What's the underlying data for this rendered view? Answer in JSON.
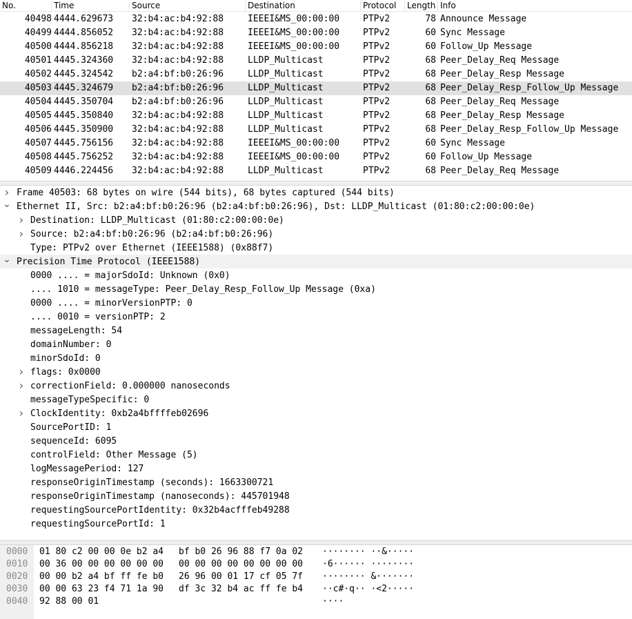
{
  "packet_list": {
    "columns": {
      "no": "No.",
      "time": "Time",
      "source": "Source",
      "destination": "Destination",
      "protocol": "Protocol",
      "length": "Length",
      "info": "Info"
    },
    "rows": [
      {
        "no": "40498",
        "time": "4444.629673",
        "source": "32:b4:ac:b4:92:88",
        "destination": "IEEEI&MS_00:00:00",
        "protocol": "PTPv2",
        "length": "78",
        "info": "Announce Message",
        "selected": false
      },
      {
        "no": "40499",
        "time": "4444.856052",
        "source": "32:b4:ac:b4:92:88",
        "destination": "IEEEI&MS_00:00:00",
        "protocol": "PTPv2",
        "length": "60",
        "info": "Sync Message",
        "selected": false
      },
      {
        "no": "40500",
        "time": "4444.856218",
        "source": "32:b4:ac:b4:92:88",
        "destination": "IEEEI&MS_00:00:00",
        "protocol": "PTPv2",
        "length": "60",
        "info": "Follow_Up Message",
        "selected": false
      },
      {
        "no": "40501",
        "time": "4445.324360",
        "source": "32:b4:ac:b4:92:88",
        "destination": "LLDP_Multicast",
        "protocol": "PTPv2",
        "length": "68",
        "info": "Peer_Delay_Req Message",
        "selected": false
      },
      {
        "no": "40502",
        "time": "4445.324542",
        "source": "b2:a4:bf:b0:26:96",
        "destination": "LLDP_Multicast",
        "protocol": "PTPv2",
        "length": "68",
        "info": "Peer_Delay_Resp Message",
        "selected": false
      },
      {
        "no": "40503",
        "time": "4445.324679",
        "source": "b2:a4:bf:b0:26:96",
        "destination": "LLDP_Multicast",
        "protocol": "PTPv2",
        "length": "68",
        "info": "Peer_Delay_Resp_Follow_Up Message",
        "selected": true
      },
      {
        "no": "40504",
        "time": "4445.350704",
        "source": "b2:a4:bf:b0:26:96",
        "destination": "LLDP_Multicast",
        "protocol": "PTPv2",
        "length": "68",
        "info": "Peer_Delay_Req Message",
        "selected": false
      },
      {
        "no": "40505",
        "time": "4445.350840",
        "source": "32:b4:ac:b4:92:88",
        "destination": "LLDP_Multicast",
        "protocol": "PTPv2",
        "length": "68",
        "info": "Peer_Delay_Resp Message",
        "selected": false
      },
      {
        "no": "40506",
        "time": "4445.350900",
        "source": "32:b4:ac:b4:92:88",
        "destination": "LLDP_Multicast",
        "protocol": "PTPv2",
        "length": "68",
        "info": "Peer_Delay_Resp_Follow_Up Message",
        "selected": false
      },
      {
        "no": "40507",
        "time": "4445.756156",
        "source": "32:b4:ac:b4:92:88",
        "destination": "IEEEI&MS_00:00:00",
        "protocol": "PTPv2",
        "length": "60",
        "info": "Sync Message",
        "selected": false
      },
      {
        "no": "40508",
        "time": "4445.756252",
        "source": "32:b4:ac:b4:92:88",
        "destination": "IEEEI&MS_00:00:00",
        "protocol": "PTPv2",
        "length": "60",
        "info": "Follow_Up Message",
        "selected": false
      },
      {
        "no": "40509",
        "time": "4446.224456",
        "source": "32:b4:ac:b4:92:88",
        "destination": "LLDP_Multicast",
        "protocol": "PTPv2",
        "length": "68",
        "info": "Peer_Delay_Req Message",
        "selected": false
      }
    ]
  },
  "details": [
    {
      "text": "Frame 40503: 68 bytes on wire (544 bits), 68 bytes captured (544 bits)",
      "level": 0,
      "expander": "collapsed",
      "highlight": false
    },
    {
      "text": "Ethernet II, Src: b2:a4:bf:b0:26:96 (b2:a4:bf:b0:26:96), Dst: LLDP_Multicast (01:80:c2:00:00:0e)",
      "level": 0,
      "expander": "expanded",
      "highlight": false
    },
    {
      "text": "Destination: LLDP_Multicast (01:80:c2:00:00:0e)",
      "level": 1,
      "expander": "collapsed",
      "highlight": false
    },
    {
      "text": "Source: b2:a4:bf:b0:26:96 (b2:a4:bf:b0:26:96)",
      "level": 1,
      "expander": "collapsed",
      "highlight": false
    },
    {
      "text": "Type: PTPv2 over Ethernet (IEEE1588) (0x88f7)",
      "level": 1,
      "expander": "none",
      "highlight": false
    },
    {
      "text": "Precision Time Protocol (IEEE1588)",
      "level": 0,
      "expander": "expanded",
      "highlight": true
    },
    {
      "text": "0000 .... = majorSdoId: Unknown (0x0)",
      "level": 1,
      "expander": "none",
      "highlight": false
    },
    {
      "text": ".... 1010 = messageType: Peer_Delay_Resp_Follow_Up Message (0xa)",
      "level": 1,
      "expander": "none",
      "highlight": false
    },
    {
      "text": "0000 .... = minorVersionPTP: 0",
      "level": 1,
      "expander": "none",
      "highlight": false
    },
    {
      "text": ".... 0010 = versionPTP: 2",
      "level": 1,
      "expander": "none",
      "highlight": false
    },
    {
      "text": "messageLength: 54",
      "level": 1,
      "expander": "none",
      "highlight": false
    },
    {
      "text": "domainNumber: 0",
      "level": 1,
      "expander": "none",
      "highlight": false
    },
    {
      "text": "minorSdoId: 0",
      "level": 1,
      "expander": "none",
      "highlight": false
    },
    {
      "text": "flags: 0x0000",
      "level": 1,
      "expander": "collapsed",
      "highlight": false
    },
    {
      "text": "correctionField: 0.000000 nanoseconds",
      "level": 1,
      "expander": "collapsed",
      "highlight": false
    },
    {
      "text": "messageTypeSpecific: 0",
      "level": 1,
      "expander": "none",
      "highlight": false
    },
    {
      "text": "ClockIdentity: 0xb2a4bffffeb02696",
      "level": 1,
      "expander": "collapsed",
      "highlight": false
    },
    {
      "text": "SourcePortID: 1",
      "level": 1,
      "expander": "none",
      "highlight": false
    },
    {
      "text": "sequenceId: 6095",
      "level": 1,
      "expander": "none",
      "highlight": false
    },
    {
      "text": "controlField: Other Message (5)",
      "level": 1,
      "expander": "none",
      "highlight": false
    },
    {
      "text": "logMessagePeriod: 127",
      "level": 1,
      "expander": "none",
      "highlight": false
    },
    {
      "text": "responseOriginTimestamp (seconds): 1663300721",
      "level": 1,
      "expander": "none",
      "highlight": false
    },
    {
      "text": "responseOriginTimestamp (nanoseconds): 445701948",
      "level": 1,
      "expander": "none",
      "highlight": false
    },
    {
      "text": "requestingSourcePortIdentity: 0x32b4acfffeb49288",
      "level": 1,
      "expander": "none",
      "highlight": false
    },
    {
      "text": "requestingSourcePortId: 1",
      "level": 1,
      "expander": "none",
      "highlight": false
    }
  ],
  "hex": [
    {
      "offset": "0000",
      "bytes1": "01 80 c2 00 00 0e b2 a4",
      "bytes2": "bf b0 26 96 88 f7 0a 02",
      "ascii": "········ ··&·····"
    },
    {
      "offset": "0010",
      "bytes1": "00 36 00 00 00 00 00 00",
      "bytes2": "00 00 00 00 00 00 00 00",
      "ascii": "·6······ ········"
    },
    {
      "offset": "0020",
      "bytes1": "00 00 b2 a4 bf ff fe b0",
      "bytes2": "26 96 00 01 17 cf 05 7f",
      "ascii": "········ &·······"
    },
    {
      "offset": "0030",
      "bytes1": "00 00 63 23 f4 71 1a 90",
      "bytes2": "df 3c 32 b4 ac ff fe b4",
      "ascii": "··c#·q·· ·<2·····"
    },
    {
      "offset": "0040",
      "bytes1": "92 88 00 01",
      "bytes2": "",
      "ascii": "····"
    }
  ],
  "icons": {
    "collapsed": "chevron-right-icon",
    "expanded": "chevron-down-icon"
  },
  "colors": {
    "selected_row": "#e1e1e1",
    "highlight_row": "#f1f1f1",
    "gutter": "#f0f0f0"
  }
}
